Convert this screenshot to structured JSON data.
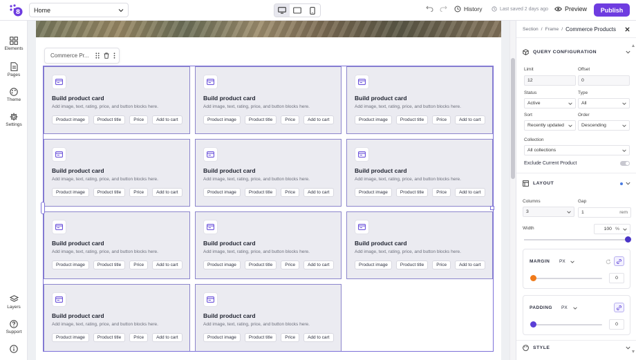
{
  "topbar": {
    "page": "Home",
    "history_label": "History",
    "saved_label": "Last saved 2 days ago",
    "preview_label": "Preview",
    "publish_label": "Publish"
  },
  "rail": {
    "elements": "Elements",
    "pages": "Pages",
    "theme": "Theme",
    "settings": "Settings",
    "layers": "Layers",
    "support": "Support"
  },
  "canvas": {
    "floater_label": "Commerce Pr...",
    "cards": [
      {
        "title": "Build product card",
        "desc": "Add image, text, rating, price, and button blocks here.",
        "chips": [
          "Product image",
          "Product title",
          "Price",
          "Add to cart"
        ]
      },
      {
        "title": "Build product card",
        "desc": "Add image, text, rating, price, and button blocks here.",
        "chips": [
          "Product image",
          "Product title",
          "Price",
          "Add to cart"
        ]
      },
      {
        "title": "Build product card",
        "desc": "Add image, text, rating, price, and button blocks here.",
        "chips": [
          "Product image",
          "Product title",
          "Price",
          "Add to cart"
        ]
      },
      {
        "title": "Build product card",
        "desc": "Add image, text, rating, price, and button blocks here.",
        "chips": [
          "Product image",
          "Product title",
          "Price",
          "Add to cart"
        ]
      },
      {
        "title": "Build product card",
        "desc": "Add image, text, rating, price, and button blocks here.",
        "chips": [
          "Product image",
          "Product title",
          "Price",
          "Add to cart"
        ]
      },
      {
        "title": "Build product card",
        "desc": "Add image, text, rating, price, and button blocks here.",
        "chips": [
          "Product image",
          "Product title",
          "Price",
          "Add to cart"
        ]
      },
      {
        "title": "Build product card",
        "desc": "Add image, text, rating, price, and button blocks here.",
        "chips": [
          "Product image",
          "Product title",
          "Price",
          "Add to cart"
        ]
      },
      {
        "title": "Build product card",
        "desc": "Add image, text, rating, price, and button blocks here.",
        "chips": [
          "Product image",
          "Product title",
          "Price",
          "Add to cart"
        ]
      },
      {
        "title": "Build product card",
        "desc": "Add image, text, rating, price, and button blocks here.",
        "chips": [
          "Product image",
          "Product title",
          "Price",
          "Add to cart"
        ]
      },
      {
        "title": "Build product card",
        "desc": "Add image, text, rating, price, and button blocks here.",
        "chips": [
          "Product image",
          "Product title",
          "Price",
          "Add to cart"
        ]
      },
      {
        "title": "Build product card",
        "desc": "Add image, text, rating, price, and button blocks here.",
        "chips": [
          "Product image",
          "Product title",
          "Price",
          "Add to cart"
        ]
      }
    ]
  },
  "panel": {
    "breadcrumb": [
      "Section",
      "Frame",
      "Commerce Products"
    ],
    "query": {
      "title": "QUERY CONFIGURATION",
      "limit_label": "Limit",
      "limit_value": "12",
      "offset_label": "Offset",
      "offset_value": "0",
      "status_label": "Status",
      "status_value": "Active",
      "type_label": "Type",
      "type_value": "All",
      "sort_label": "Sort",
      "sort_value": "Recently updated",
      "order_label": "Order",
      "order_value": "Descending",
      "collection_label": "Collection",
      "collection_value": "All collections",
      "exclude_label": "Exclude Current Product"
    },
    "layout": {
      "title": "LAYOUT",
      "columns_label": "Columns",
      "columns_value": "3",
      "gap_label": "Gap",
      "gap_value": "1",
      "gap_unit": "rem",
      "width_label": "Width",
      "width_value": "100",
      "width_unit": "%",
      "width_percent": 100
    },
    "margin": {
      "label": "MARGIN",
      "unit": "PX",
      "value": "0"
    },
    "padding": {
      "label": "PADDING",
      "unit": "PX",
      "value": "0"
    },
    "style": {
      "title": "STYLE"
    },
    "colors": {
      "accent": "#6e3ce0",
      "margin_knob": "#f07a1a",
      "padding_knob": "#5b3fd6",
      "width_knob": "#4a34c7"
    }
  }
}
